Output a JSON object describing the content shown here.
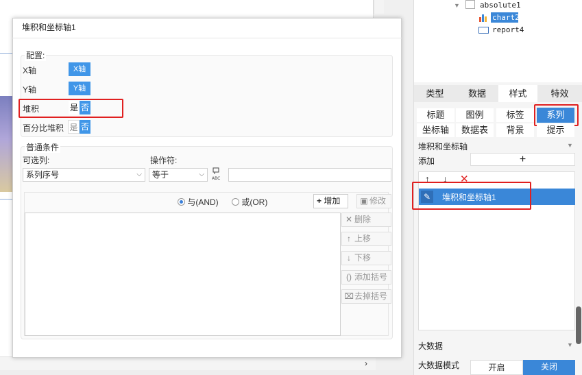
{
  "tree": {
    "items": [
      "absolute1",
      "chart2",
      "report4"
    ]
  },
  "dialog": {
    "title": "堆积和坐标轴1",
    "config": {
      "legend": "配置:",
      "x_axis_label": "X轴",
      "x_axis_value": "X轴",
      "y_axis_label": "Y轴",
      "y_axis_value": "Y轴",
      "stack_label": "堆积",
      "stack_yes": "是",
      "stack_no": "否",
      "stack_selected": "否",
      "percent_label": "百分比堆积",
      "percent_yes": "是",
      "percent_no": "否",
      "percent_selected": "否"
    },
    "condition": {
      "legend": "普通条件",
      "column_label": "可选列:",
      "column_value": "系列序号",
      "operator_label": "操作符:",
      "operator_value": "等于",
      "value_input": "",
      "and_label": "与(AND)",
      "or_label": "或(OR)",
      "logic_selected": "and",
      "add_button": "增加",
      "modify_button": "修改",
      "delete_button": "删除",
      "move_up_button": "上移",
      "move_down_button": "下移",
      "add_bracket_button": "添加括号",
      "remove_bracket_button": "去掉括号"
    }
  },
  "right_panel": {
    "tabs": [
      "类型",
      "数据",
      "样式",
      "特效"
    ],
    "active_tab": "样式",
    "sub_tabs_row1": [
      "标题",
      "图例",
      "标签",
      "系列"
    ],
    "sub_tabs_row2": [
      "坐标轴",
      "数据表",
      "背景",
      "提示"
    ],
    "active_sub_tab": "系列",
    "section_stack_axis": "堆积和坐标轴",
    "add_label": "添加",
    "list_items": [
      "堆积和坐标轴1"
    ],
    "section_big_data": "大数据",
    "big_data_mode_label": "大数据模式",
    "toggle_on": "开启",
    "toggle_off": "关闭",
    "toggle_selected": "关闭"
  },
  "colors": {
    "accent": "#3a87d8",
    "highlight": "#e02020"
  }
}
